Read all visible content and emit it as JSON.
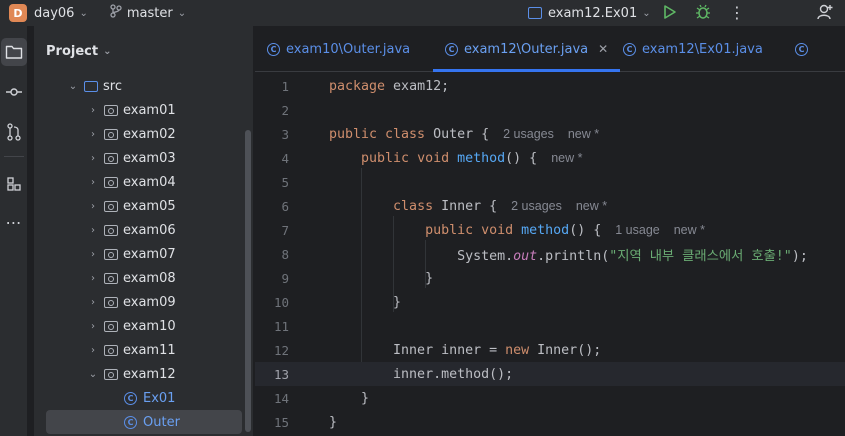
{
  "titlebar": {
    "project_badge": "D",
    "project_name": "day06",
    "branch_name": "master",
    "run_config": "exam12.Ex01"
  },
  "toolstrip": {
    "items": [
      "folder-icon",
      "commit-icon",
      "pull-requests-icon",
      "structure-icon",
      "more-icon"
    ]
  },
  "project_pane": {
    "title": "Project",
    "tree": [
      {
        "label": "src",
        "type": "source-root",
        "expanded": true
      },
      {
        "label": "exam01",
        "type": "package"
      },
      {
        "label": "exam02",
        "type": "package"
      },
      {
        "label": "exam03",
        "type": "package"
      },
      {
        "label": "exam04",
        "type": "package"
      },
      {
        "label": "exam05",
        "type": "package"
      },
      {
        "label": "exam06",
        "type": "package"
      },
      {
        "label": "exam07",
        "type": "package"
      },
      {
        "label": "exam08",
        "type": "package"
      },
      {
        "label": "exam09",
        "type": "package"
      },
      {
        "label": "exam10",
        "type": "package"
      },
      {
        "label": "exam11",
        "type": "package"
      },
      {
        "label": "exam12",
        "type": "package",
        "expanded": true
      },
      {
        "label": "Ex01",
        "type": "class"
      },
      {
        "label": "Outer",
        "type": "class",
        "selected": true
      }
    ]
  },
  "tabs": [
    {
      "label": "exam10\\Outer.java"
    },
    {
      "label": "exam12\\Outer.java",
      "active": true
    },
    {
      "label": "exam12\\Ex01.java"
    }
  ],
  "editor": {
    "current_line": 13,
    "line_numbers": [
      "1",
      "2",
      "3",
      "4",
      "5",
      "6",
      "7",
      "8",
      "9",
      "10",
      "11",
      "12",
      "13",
      "14",
      "15"
    ],
    "hints": {
      "outer_usages": "2 usages",
      "outer_new": "new *",
      "method_new": "new *",
      "inner_usages": "2 usages",
      "inner_new": "new *",
      "inner_method_usages": "1 usage",
      "inner_method_new": "new *"
    },
    "string_literal": "\"지역 내부 클래스에서 호출!\""
  },
  "colors": {
    "keyword": "#cf8e6d",
    "function": "#56a8f5",
    "string": "#6aab73",
    "static_field": "#c77dbb",
    "accent": "#3574f0"
  }
}
